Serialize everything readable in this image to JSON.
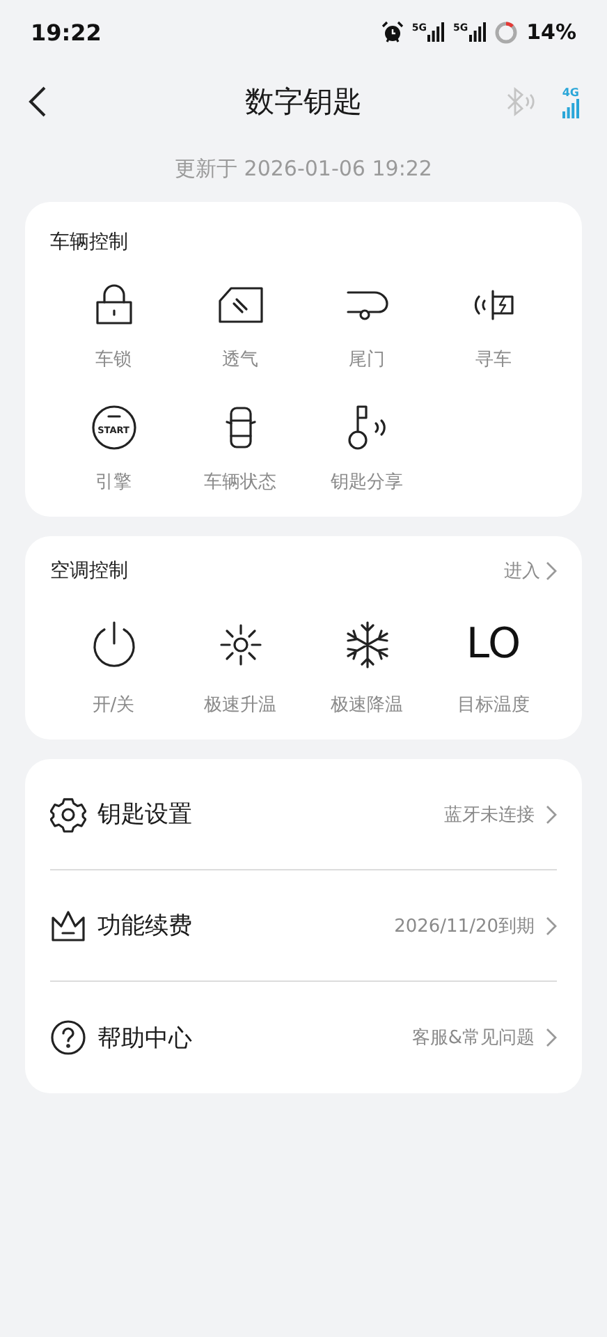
{
  "status_bar": {
    "time": "19:22",
    "sims": [
      "5G",
      "5G"
    ],
    "battery": "14%"
  },
  "header": {
    "title": "数字钥匙",
    "network": "4G"
  },
  "updated": "更新于 2026-01-06 19:22",
  "vehicle_control": {
    "title": "车辆控制",
    "items": [
      {
        "kind": "lock",
        "label": "车锁"
      },
      {
        "kind": "vent",
        "label": "透气"
      },
      {
        "kind": "tailgate",
        "label": "尾门"
      },
      {
        "kind": "find",
        "label": "寻车"
      },
      {
        "kind": "engine",
        "label": "引擎",
        "badge": "START"
      },
      {
        "kind": "status",
        "label": "车辆状态"
      },
      {
        "kind": "share",
        "label": "钥匙分享"
      }
    ]
  },
  "climate_control": {
    "title": "空调控制",
    "link": "进入",
    "items": [
      {
        "kind": "power",
        "label": "开/关"
      },
      {
        "kind": "heat",
        "label": "极速升温"
      },
      {
        "kind": "cool",
        "label": "极速降温"
      },
      {
        "kind": "value",
        "value": "LO",
        "label": "目标温度"
      }
    ]
  },
  "menu": [
    {
      "kind": "settings",
      "label": "钥匙设置",
      "detail": "蓝牙未连接"
    },
    {
      "kind": "renew",
      "label": "功能续费",
      "detail": "2026/11/20到期"
    },
    {
      "kind": "help",
      "label": "帮助中心",
      "detail": "客服&常见问题"
    }
  ]
}
